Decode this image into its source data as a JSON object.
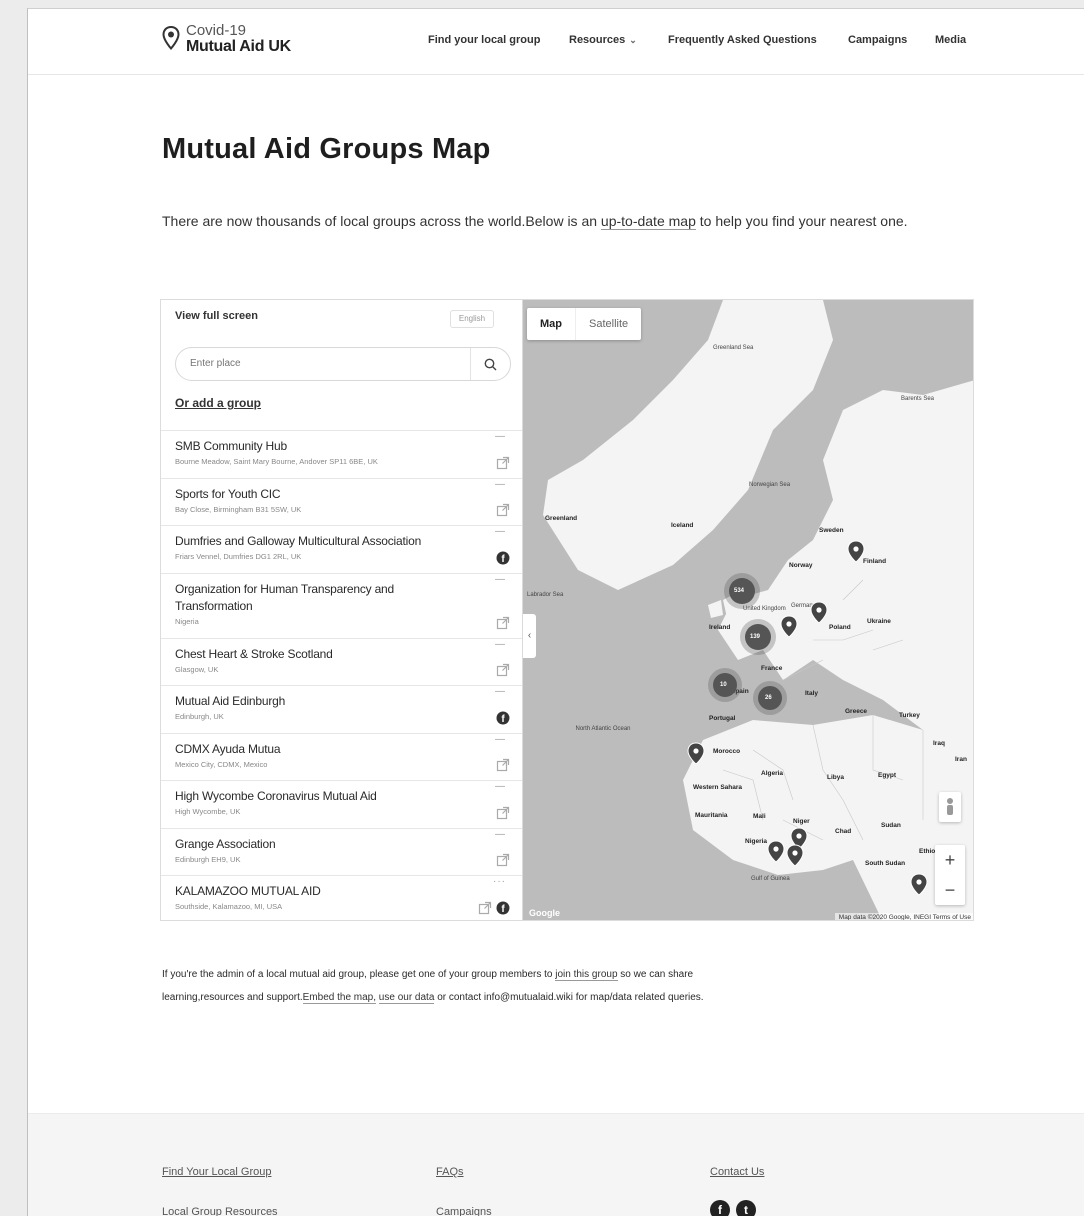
{
  "header": {
    "logo_line1": "Covid-19",
    "logo_line2": "Mutual Aid UK",
    "nav": [
      {
        "label": "Find your local group"
      },
      {
        "label": "Resources",
        "has_dropdown": true
      },
      {
        "label": "Frequently Asked Questions"
      },
      {
        "label": "Campaigns"
      },
      {
        "label": "Media"
      }
    ]
  },
  "main": {
    "title": "Mutual Aid Groups Map",
    "intro_before": "There are now thousands of local groups across the world.Below is an",
    "intro_link": "up-to-date map",
    "intro_after": "to help you find your nearest one."
  },
  "widget": {
    "view_full_screen": "View full screen",
    "language": "English",
    "search_placeholder": "Enter place",
    "add_group": "Or add a group",
    "groups": [
      {
        "name": "SMB Community Hub",
        "address": "Bourne Meadow, Saint Mary Bourne, Andover SP11 6BE, UK",
        "icon": "external-link-icon"
      },
      {
        "name": "Sports for Youth CIC",
        "address": "Bay Close, Birmingham B31 5SW, UK",
        "icon": "external-link-icon"
      },
      {
        "name": "Dumfries and Galloway Multicultural Association",
        "address": "Friars Vennel, Dumfries DG1 2RL, UK",
        "icon": "facebook-icon"
      },
      {
        "name": "Organization for Human Transparency and Transformation",
        "address": "Nigeria",
        "icon": "external-link-icon",
        "tall": true
      },
      {
        "name": "Chest Heart & Stroke Scotland",
        "address": "Glasgow, UK",
        "icon": "external-link-icon"
      },
      {
        "name": "Mutual Aid Edinburgh",
        "address": "Edinburgh, UK",
        "icon": "facebook-icon"
      },
      {
        "name": "CDMX Ayuda Mutua",
        "address": "Mexico City, CDMX, Mexico",
        "icon": "external-link-icon"
      },
      {
        "name": "High Wycombe Coronavirus Mutual Aid",
        "address": "High Wycombe, UK",
        "icon": "external-link-icon"
      },
      {
        "name": "Grange Association",
        "address": "Edinburgh EH9, UK",
        "icon": "external-link-icon"
      },
      {
        "name": "KALAMAZOO MUTUAL AID",
        "address": "Southside, Kalamazoo, MI, USA",
        "icon": "external-link-icon",
        "second_icon": "facebook-icon"
      }
    ],
    "map": {
      "type_map": "Map",
      "type_satellite": "Satellite",
      "zoom_in": "+",
      "zoom_out": "−",
      "attribution": "Map data ©2020 Google, INEGI   Terms of Use",
      "google": "Google",
      "labels": [
        "Greenland Sea",
        "Barents Sea",
        "Norwegian Sea",
        "Greenland",
        "Iceland",
        "Sweden",
        "Finland",
        "Norway",
        "Labrador Sea",
        "United Kingdom",
        "Ireland",
        "Germany",
        "Poland",
        "Ukraine",
        "France",
        "Spain",
        "Portugal",
        "Italy",
        "Greece",
        "Turkey",
        "Iraq",
        "Iran",
        "Morocco",
        "Algeria",
        "Libya",
        "Egypt",
        "Western Sahara",
        "Mauritania",
        "Mali",
        "Niger",
        "Chad",
        "Sudan",
        "Nigeria",
        "Ethiopia",
        "South Sudan",
        "Gulf of Guinea",
        "North Atlantic Ocean"
      ],
      "clusters": [
        "534",
        "139",
        "10",
        "26"
      ]
    }
  },
  "admin_note": {
    "before": "If you're the admin of a local mutual aid group, please get one of your group members to",
    "link1": "join this group",
    "middle": "so we can share learning,resources and support.",
    "link2": "Embed the map,",
    "link3": "use our data",
    "after": "or contact info@mutualaid.wiki for map/data related queries."
  },
  "footer": {
    "col1": [
      "Find Your Local Group",
      "Local Group Resources"
    ],
    "col2": [
      "FAQs",
      "Campaigns"
    ],
    "col3": [
      "Contact Us"
    ],
    "social": [
      "facebook-icon",
      "twitter-icon"
    ]
  }
}
